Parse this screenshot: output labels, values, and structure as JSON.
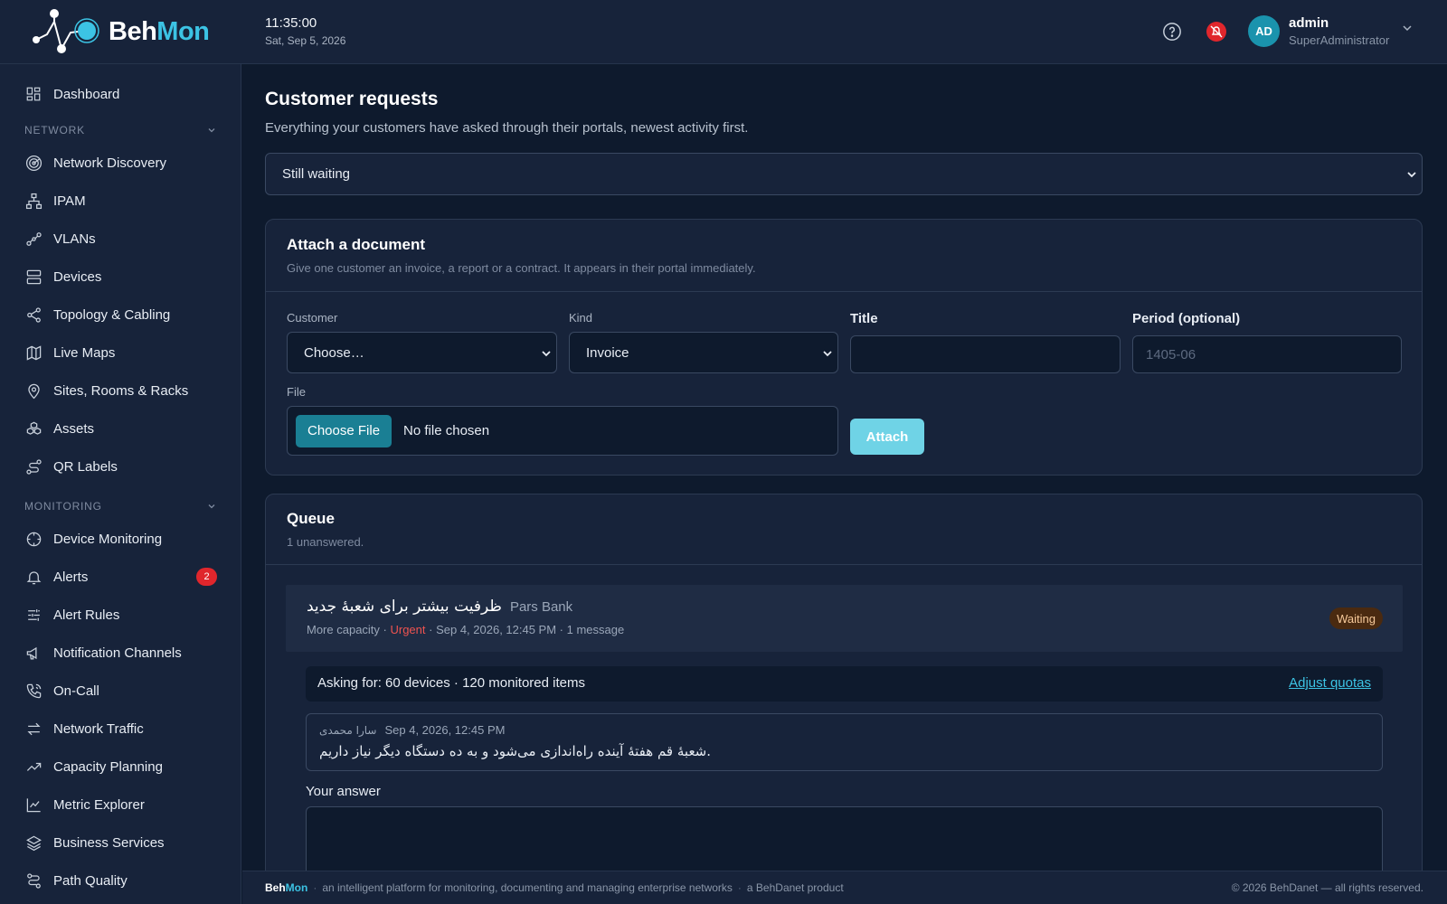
{
  "app": {
    "brand_left": "Beh",
    "brand_right": "Mon"
  },
  "header": {
    "time": "11:35:00",
    "date": "Sat, Sep 5, 2026",
    "user": {
      "initials": "AD",
      "name": "admin",
      "role": "SuperAdministrator"
    },
    "icons": [
      "help-circle-icon",
      "bell-off-icon",
      "chevron-down-icon"
    ]
  },
  "sidebar": {
    "top": {
      "label": "Dashboard",
      "icon": "grid-icon"
    },
    "sections": [
      {
        "label": "NETWORK",
        "items": [
          {
            "label": "Network Discovery",
            "icon": "radar-icon"
          },
          {
            "label": "IPAM",
            "icon": "sitemap-icon"
          },
          {
            "label": "VLANs",
            "icon": "share-nodes-icon"
          },
          {
            "label": "Devices",
            "icon": "server-icon"
          },
          {
            "label": "Topology & Cabling",
            "icon": "share-icon"
          },
          {
            "label": "Live Maps",
            "icon": "map-icon"
          },
          {
            "label": "Sites, Rooms & Racks",
            "icon": "map-pin-icon"
          },
          {
            "label": "Assets",
            "icon": "boxes-icon"
          },
          {
            "label": "QR Labels",
            "icon": "route-icon"
          }
        ]
      },
      {
        "label": "MONITORING",
        "items": [
          {
            "label": "Device Monitoring",
            "icon": "crosshair-icon"
          },
          {
            "label": "Alerts",
            "icon": "bell-icon",
            "badge": "2"
          },
          {
            "label": "Alert Rules",
            "icon": "sliders-icon"
          },
          {
            "label": "Notification Channels",
            "icon": "megaphone-icon"
          },
          {
            "label": "On-Call",
            "icon": "phone-icon"
          },
          {
            "label": "Network Traffic",
            "icon": "arrows-exchange-icon"
          },
          {
            "label": "Capacity Planning",
            "icon": "trending-up-icon"
          },
          {
            "label": "Metric Explorer",
            "icon": "line-chart-icon"
          },
          {
            "label": "Business Services",
            "icon": "layers-icon"
          },
          {
            "label": "Path Quality",
            "icon": "path-icon"
          }
        ]
      }
    ]
  },
  "page": {
    "title": "Customer requests",
    "subtitle": "Everything your customers have asked through their portals, newest activity first.",
    "filter": {
      "selected": "Still waiting"
    }
  },
  "attach": {
    "title": "Attach a document",
    "subtitle": "Give one customer an invoice, a report or a contract. It appears in their portal immediately.",
    "customer_label": "Customer",
    "customer_value": "Choose…",
    "kind_label": "Kind",
    "kind_value": "Invoice",
    "title_label": "Title",
    "title_value": "",
    "period_label": "Period (optional)",
    "period_placeholder": "1405-06",
    "file_label": "File",
    "file_button": "Choose File",
    "file_status": "No file chosen",
    "attach_button": "Attach"
  },
  "queue": {
    "title": "Queue",
    "subtitle": "1 unanswered.",
    "request": {
      "title": "ظرفیت بیشتر برای شعبهٔ جدید",
      "customer": "Pars Bank",
      "category": "More capacity",
      "priority": "Urgent",
      "created": "Sep 4, 2026, 12:45 PM",
      "messages": "1 message",
      "status": "Waiting",
      "asking": "Asking for: 60 devices · 120 monitored items",
      "adjust_link": "Adjust quotas",
      "message": {
        "author": "سارا محمدی",
        "time": "Sep 4, 2026, 12:45 PM",
        "body": "شعبهٔ قم هفتهٔ آینده راه‌اندازی می‌شود و به ده دستگاه دیگر نیاز داریم."
      },
      "answer_label": "Your answer",
      "answer_value": ""
    }
  },
  "footer": {
    "brand_left": "Beh",
    "brand_right": "Mon",
    "tagline": "an intelligent platform for monitoring, documenting and managing enterprise networks",
    "product": "a BehDanet product",
    "copyright": "© 2026 BehDanet — all rights reserved."
  },
  "colors": {
    "accent": "#3cc3e4",
    "background": "#0e1a2d",
    "panel": "#17233a",
    "urgent": "#ef5350",
    "badge": "#e0262c"
  }
}
